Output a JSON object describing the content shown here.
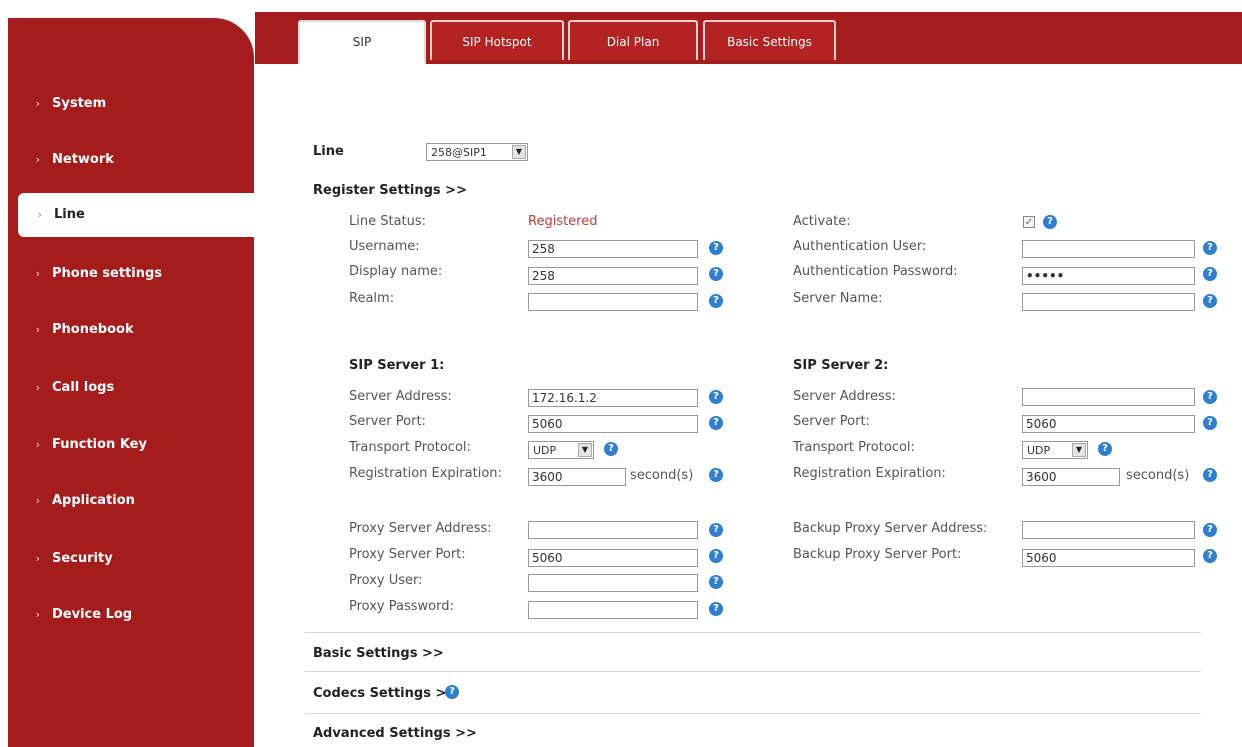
{
  "tabs": [
    {
      "label": "SIP"
    },
    {
      "label": "SIP Hotspot"
    },
    {
      "label": "Dial Plan"
    },
    {
      "label": "Basic Settings"
    }
  ],
  "sidebar": {
    "items": [
      {
        "label": "System"
      },
      {
        "label": "Network"
      },
      {
        "label": "Line"
      },
      {
        "label": "Phone settings"
      },
      {
        "label": "Phonebook"
      },
      {
        "label": "Call logs"
      },
      {
        "label": "Function Key"
      },
      {
        "label": "Application"
      },
      {
        "label": "Security"
      },
      {
        "label": "Device Log"
      }
    ]
  },
  "line": {
    "label": "Line",
    "value": "258@SIP1"
  },
  "register": {
    "header": "Register Settings >>",
    "line_status_label": "Line Status:",
    "line_status_value": "Registered",
    "username_label": "Username:",
    "username_value": "258",
    "display_name_label": "Display name:",
    "display_name_value": "258",
    "realm_label": "Realm:",
    "realm_value": "",
    "activate_label": "Activate:",
    "activate_checked": true,
    "auth_user_label": "Authentication User:",
    "auth_user_value": "",
    "auth_pass_label": "Authentication Password:",
    "auth_pass_value": "•••••",
    "server_name_label": "Server Name:",
    "server_name_value": ""
  },
  "server1": {
    "header": "SIP Server 1:",
    "address_label": "Server Address:",
    "address_value": "172.16.1.2",
    "port_label": "Server Port:",
    "port_value": "5060",
    "transport_label": "Transport Protocol:",
    "transport_value": "UDP",
    "expiration_label": "Registration Expiration:",
    "expiration_value": "3600",
    "unit": "second(s)"
  },
  "server2": {
    "header": "SIP Server 2:",
    "address_label": "Server Address:",
    "address_value": "",
    "port_label": "Server Port:",
    "port_value": "5060",
    "transport_label": "Transport Protocol:",
    "transport_value": "UDP",
    "expiration_label": "Registration Expiration:",
    "expiration_value": "3600",
    "unit": "second(s)"
  },
  "proxy": {
    "address_label": "Proxy Server Address:",
    "address_value": "",
    "port_label": "Proxy Server Port:",
    "port_value": "5060",
    "user_label": "Proxy User:",
    "user_value": "",
    "password_label": "Proxy Password:",
    "password_value": "",
    "backup_address_label": "Backup Proxy Server Address:",
    "backup_address_value": "",
    "backup_port_label": "Backup Proxy Server Port:",
    "backup_port_value": "5060"
  },
  "sections": {
    "basic": "Basic Settings >>",
    "codecs": "Codecs Settings >>",
    "advanced": "Advanced Settings >>"
  },
  "help_glyph": "?",
  "checkmark_glyph": "✓",
  "dropdown_glyph": "▼",
  "colors": {
    "brand_red": "#a51c1c",
    "status_red": "#c33a3a",
    "help_blue": "#2f7fd0"
  }
}
